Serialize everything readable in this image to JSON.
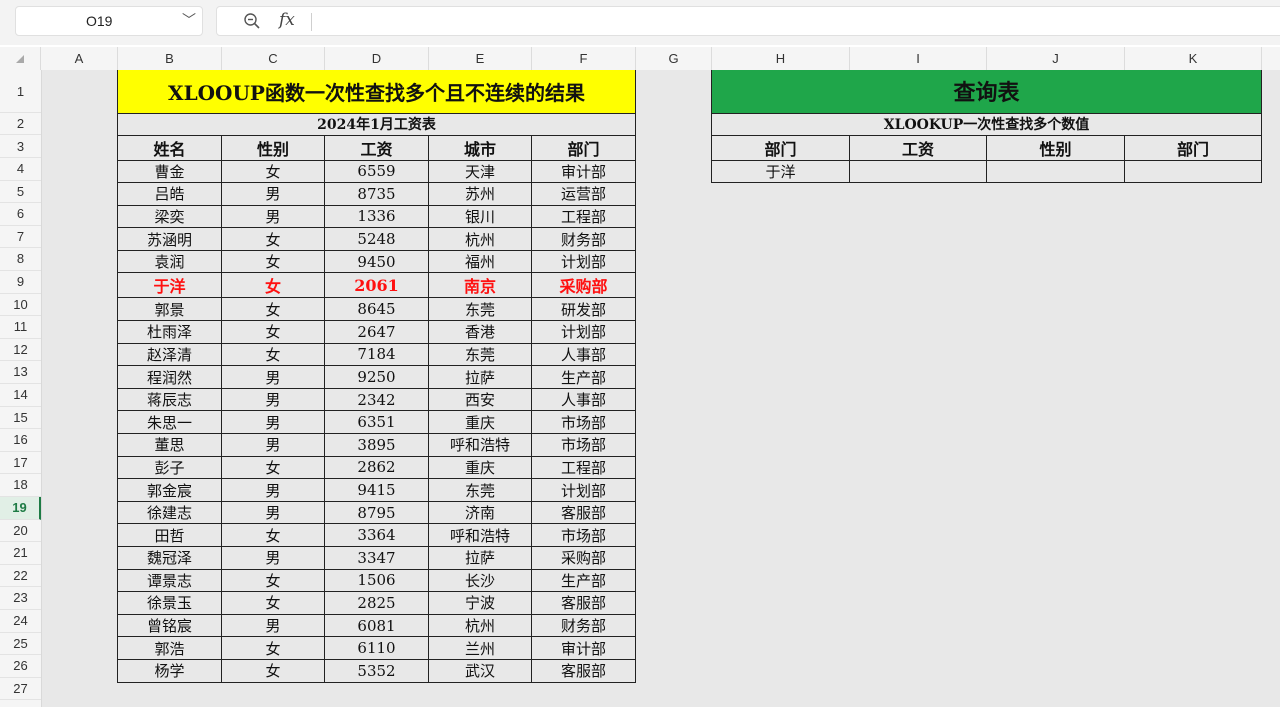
{
  "formula_bar": {
    "name_box": "O19",
    "name_box_arrow": "﹀",
    "zoom_icon": "zoom-icon",
    "fx_label": "fx"
  },
  "columns": [
    "A",
    "B",
    "C",
    "D",
    "E",
    "F",
    "G",
    "H",
    "I",
    "J",
    "K"
  ],
  "rows": [
    "1",
    "2",
    "3",
    "4",
    "5",
    "6",
    "7",
    "8",
    "9",
    "10",
    "11",
    "12",
    "13",
    "14",
    "15",
    "16",
    "17",
    "18",
    "19",
    "20",
    "21",
    "22",
    "23",
    "24",
    "25",
    "26",
    "27"
  ],
  "selected_row": "19",
  "main_table": {
    "title": "XLOOUP函数一次性查找多个且不连续的结果",
    "subtitle": "2024年1月工资表",
    "headers": [
      "姓名",
      "性别",
      "工资",
      "城市",
      "部门"
    ],
    "highlight_color": "#ff1010",
    "title_bg": "#ffff00",
    "highlight_row_index": 5,
    "rows": [
      [
        "曹金",
        "女",
        "6559",
        "天津",
        "审计部"
      ],
      [
        "吕皓",
        "男",
        "8735",
        "苏州",
        "运营部"
      ],
      [
        "梁奕",
        "男",
        "1336",
        "银川",
        "工程部"
      ],
      [
        "苏涵明",
        "女",
        "5248",
        "杭州",
        "财务部"
      ],
      [
        "袁润",
        "女",
        "9450",
        "福州",
        "计划部"
      ],
      [
        "于洋",
        "女",
        "2061",
        "南京",
        "采购部"
      ],
      [
        "郭景",
        "女",
        "8645",
        "东莞",
        "研发部"
      ],
      [
        "杜雨泽",
        "女",
        "2647",
        "香港",
        "计划部"
      ],
      [
        "赵泽清",
        "女",
        "7184",
        "东莞",
        "人事部"
      ],
      [
        "程润然",
        "男",
        "9250",
        "拉萨",
        "生产部"
      ],
      [
        "蒋辰志",
        "男",
        "2342",
        "西安",
        "人事部"
      ],
      [
        "朱思一",
        "男",
        "6351",
        "重庆",
        "市场部"
      ],
      [
        "董思",
        "男",
        "3895",
        "呼和浩特",
        "市场部"
      ],
      [
        "彭子",
        "女",
        "2862",
        "重庆",
        "工程部"
      ],
      [
        "郭金宸",
        "男",
        "9415",
        "东莞",
        "计划部"
      ],
      [
        "徐建志",
        "男",
        "8795",
        "济南",
        "客服部"
      ],
      [
        "田哲",
        "女",
        "3364",
        "呼和浩特",
        "市场部"
      ],
      [
        "魏冠泽",
        "男",
        "3347",
        "拉萨",
        "采购部"
      ],
      [
        "谭景志",
        "女",
        "1506",
        "长沙",
        "生产部"
      ],
      [
        "徐景玉",
        "女",
        "2825",
        "宁波",
        "客服部"
      ],
      [
        "曾铭宸",
        "男",
        "6081",
        "杭州",
        "财务部"
      ],
      [
        "郭浩",
        "女",
        "6110",
        "兰州",
        "审计部"
      ],
      [
        "杨学",
        "女",
        "5352",
        "武汉",
        "客服部"
      ]
    ]
  },
  "lookup_table": {
    "title": "查询表",
    "title_bg": "#1fa64a",
    "subtitle": "XLOOKUP一次性查找多个数值",
    "headers": [
      "部门",
      "工资",
      "性别",
      "部门"
    ],
    "row": [
      "于洋",
      "",
      "",
      ""
    ]
  }
}
